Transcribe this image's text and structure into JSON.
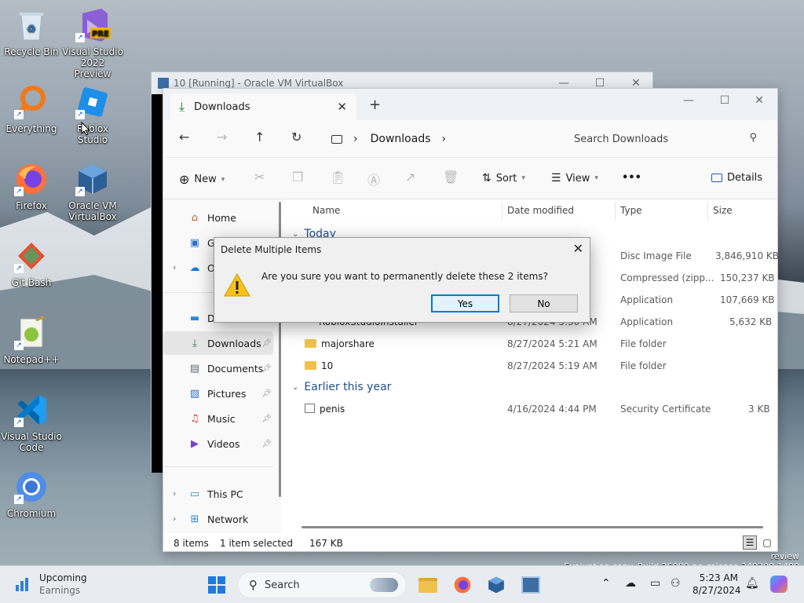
{
  "desktop": {
    "icons": [
      {
        "label": "Recycle Bin"
      },
      {
        "label": "Visual Studio 2022 Preview",
        "badge": "PRE"
      },
      {
        "label": "Everything"
      },
      {
        "label": "Roblox Studio"
      },
      {
        "label": "Firefox"
      },
      {
        "label": "Oracle VM VirtualBox"
      },
      {
        "label": "Git Bash"
      },
      {
        "label": "Notepad++"
      },
      {
        "label": "Visual Studio Code"
      },
      {
        "label": "Chromium"
      }
    ],
    "evaluation_line1": "review",
    "evaluation_line2": "Evaluation copy. Build 26080.ge_release.240308-1400"
  },
  "vbox": {
    "title": "10 [Running] - Oracle VM VirtualBox"
  },
  "explorer": {
    "tab_title": "Downloads",
    "breadcrumb": "Downloads",
    "search_placeholder": "Search Downloads",
    "commands": {
      "new": "New",
      "sort": "Sort",
      "view": "View",
      "more": "•••",
      "details": "Details"
    },
    "sidebar": {
      "home": "Home",
      "gallery": "Ga",
      "onedrive": "O",
      "desktop": "D",
      "downloads": "Downloads",
      "documents": "Documents",
      "pictures": "Pictures",
      "music": "Music",
      "videos": "Videos",
      "this_pc": "This PC",
      "network": "Network"
    },
    "columns": {
      "name": "Name",
      "date": "Date modified",
      "type": "Type",
      "size": "Size"
    },
    "groups": {
      "today": "Today",
      "earlier": "Earlier this year"
    },
    "rows": [
      {
        "name": "",
        "date": "",
        "type": "Disc Image File",
        "size": "3,846,910 KB"
      },
      {
        "name": "",
        "date": "",
        "type": "Compressed (zipp...",
        "size": "150,237 KB"
      },
      {
        "name": "",
        "date": "",
        "type": "Application",
        "size": "107,669 KB"
      },
      {
        "name": "RobloxStudioInstaller",
        "date": "8/27/2024 5:30 AM",
        "type": "Application",
        "size": "5,632 KB"
      },
      {
        "name": "majorshare",
        "date": "8/27/2024 5:21 AM",
        "type": "File folder",
        "size": ""
      },
      {
        "name": "10",
        "date": "8/27/2024 5:19 AM",
        "type": "File folder",
        "size": ""
      },
      {
        "name": "penis",
        "date": "4/16/2024 4:44 PM",
        "type": "Security Certificate",
        "size": "3 KB"
      }
    ],
    "status": {
      "count": "8 items",
      "selected": "1 item selected",
      "selected_size": "167 KB"
    }
  },
  "dialog": {
    "title": "Delete Multiple Items",
    "message": "Are you sure you want to permanently delete these 2 items?",
    "yes": "Yes",
    "no": "No"
  },
  "taskbar": {
    "widget_title": "Upcoming",
    "widget_sub": "Earnings",
    "search": "Search",
    "time": "5:23 AM",
    "date": "8/27/2024"
  }
}
